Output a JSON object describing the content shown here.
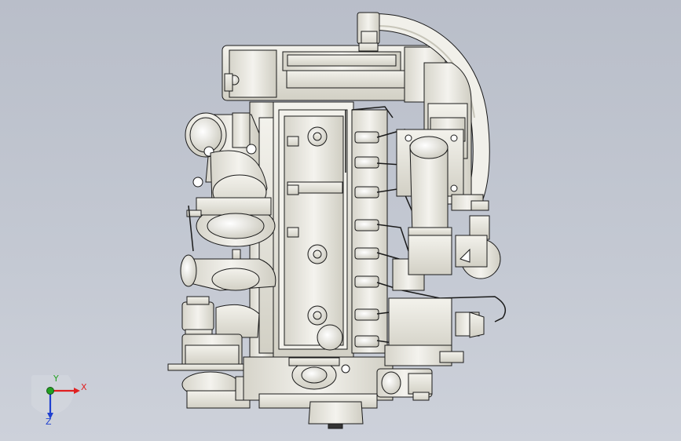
{
  "viewport": {
    "background_top": "#b9bec9",
    "background_bottom": "#cdd1da",
    "model": "engine-assembly",
    "part_fill": "#ecebe4",
    "part_shade": "#d3d1c6",
    "edge_color": "#1a1a1a"
  },
  "triad": {
    "x_label": "X",
    "y_label": "Y",
    "z_label": "Z",
    "x_color": "#e02020",
    "y_color": "#22a022",
    "z_color": "#2040d0"
  }
}
